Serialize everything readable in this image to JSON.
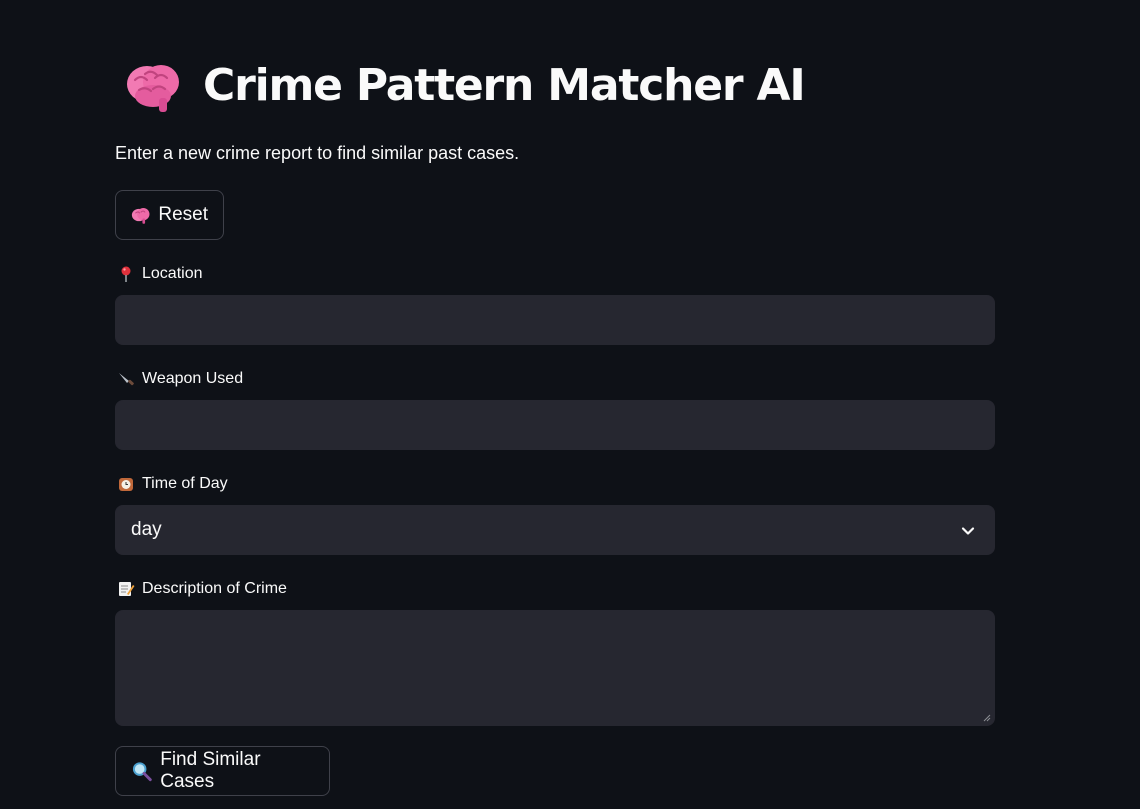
{
  "header": {
    "icon": "brain-icon",
    "title": "Crime Pattern Matcher AI",
    "subtitle": "Enter a new crime report to find similar past cases."
  },
  "reset_button": {
    "icon": "brain-icon",
    "label": "Reset"
  },
  "form": {
    "location": {
      "icon": "pin-icon",
      "label": "Location",
      "value": ""
    },
    "weapon": {
      "icon": "knife-icon",
      "label": "Weapon Used",
      "value": ""
    },
    "time_of_day": {
      "icon": "clock-icon",
      "label": "Time of Day",
      "value": "day"
    },
    "description": {
      "icon": "memo-icon",
      "label": "Description of Crime",
      "value": ""
    }
  },
  "find_button": {
    "icon": "magnifier-icon",
    "label": "Find Similar Cases"
  },
  "colors": {
    "background": "#0e1117",
    "input_background": "#262730",
    "button_border": "#3f414a",
    "text": "#fafafa"
  }
}
